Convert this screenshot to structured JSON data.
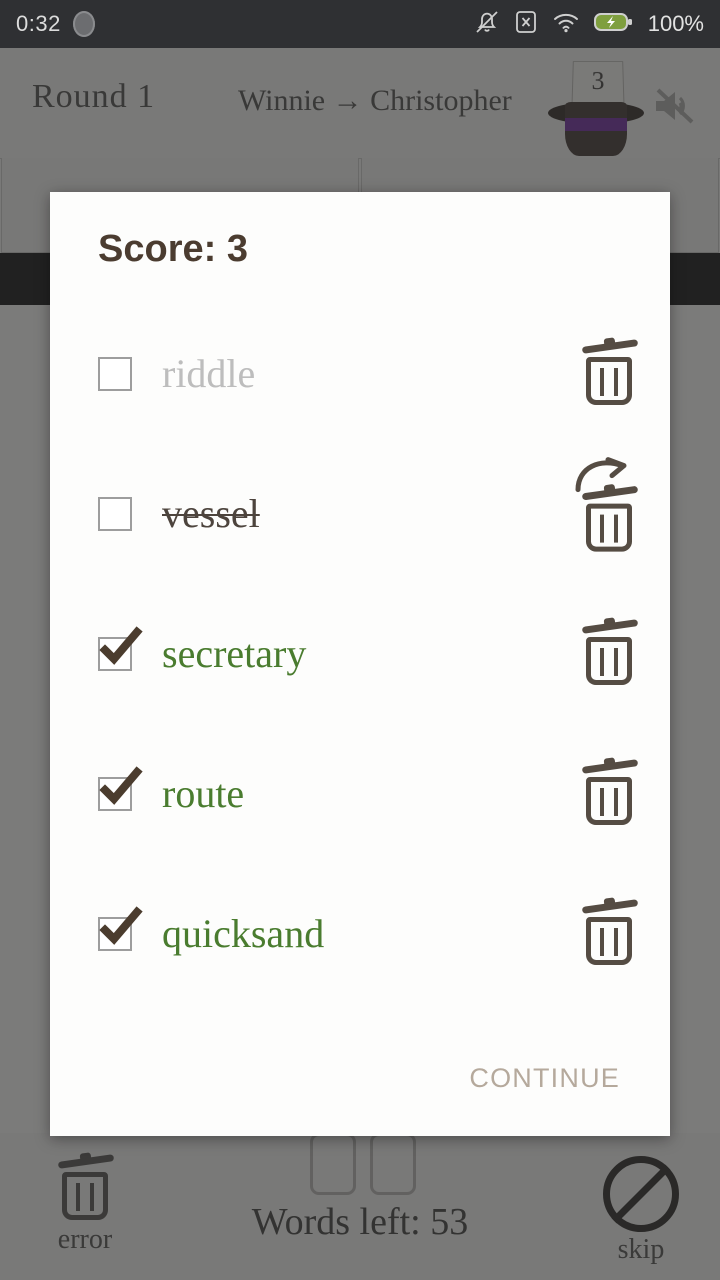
{
  "status_bar": {
    "clock": "0:32",
    "battery_percent": "100%",
    "icons": [
      "notification-dot-icon",
      "bell-muted-icon",
      "sim-card-error-icon",
      "wifi-icon",
      "battery-charging-icon"
    ]
  },
  "game": {
    "round_label": "Round 1",
    "teams_label": "Winnie → Christopher",
    "hat_card_number": "3",
    "mute_icon": "speaker-muted-icon",
    "words_left_label": "Words left: 53",
    "error_label": "error",
    "skip_label": "skip",
    "error_icon": "trash-icon",
    "skip_icon": "no-entry-icon"
  },
  "dialog": {
    "title": "Score: 3",
    "continue_label": "CONTINUE",
    "words": [
      {
        "text": "riddle",
        "state": "pending",
        "checked": false,
        "trash_icon": "trash-icon"
      },
      {
        "text": "vessel",
        "state": "struck",
        "checked": false,
        "trash_icon": "trash-restore-icon"
      },
      {
        "text": "secretary",
        "state": "checked",
        "checked": true,
        "trash_icon": "trash-icon"
      },
      {
        "text": "route",
        "state": "checked",
        "checked": true,
        "trash_icon": "trash-icon"
      },
      {
        "text": "quicksand",
        "state": "checked",
        "checked": true,
        "trash_icon": "trash-icon"
      }
    ]
  },
  "colors": {
    "correct_green": "#4a7c2f",
    "brown_dark": "#4b3c30",
    "trash_brown": "#554c43",
    "continue_tan": "#b5a99c",
    "hat_band_purple": "#6a229c",
    "pending_gray": "#bdbdbd"
  }
}
